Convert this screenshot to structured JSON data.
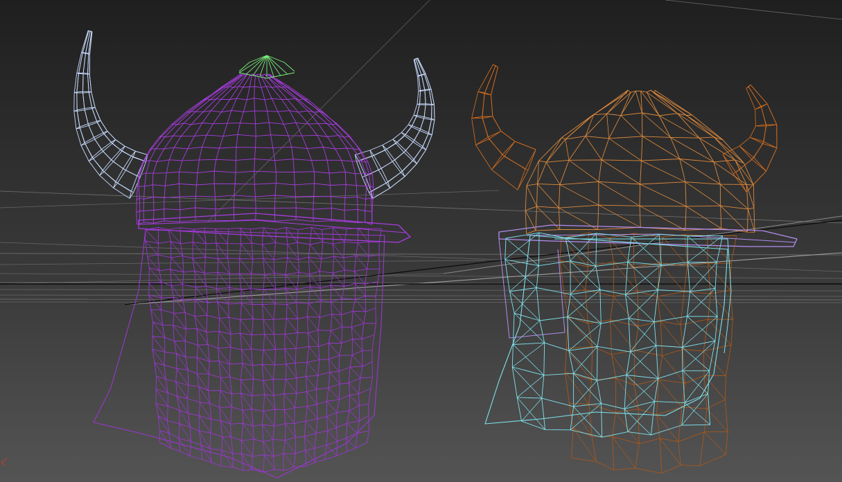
{
  "viewport": {
    "background_top": "#212121",
    "background_bottom": "#505050",
    "grid_color": "#8c8c8c",
    "grid_color_light": "#a6a6a6"
  },
  "models": [
    {
      "name": "high-poly-viking-helmet",
      "parts": {
        "horns": "#c8dcff",
        "shell": "#a83ce0",
        "knob": "#7cf07c",
        "face_guard": "#9a36cf"
      }
    },
    {
      "name": "low-poly-viking-helmet",
      "parts": {
        "horns": "#cc6a1e",
        "shell": "#dd8a3c",
        "face_guard": "#7fe3ee",
        "brim": "#b48cf0",
        "back": "#a8571c"
      }
    }
  ],
  "axis": {
    "origin_marker_color": "#d43a2a"
  }
}
